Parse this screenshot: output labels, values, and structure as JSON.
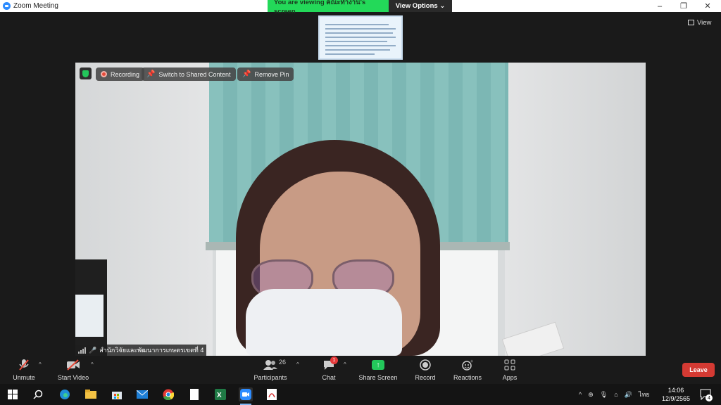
{
  "window": {
    "title": "Zoom Meeting",
    "min": "–",
    "restore": "❐",
    "close": "✕"
  },
  "banner": {
    "viewing": "You are viewing คณะทำงาน's screen",
    "view_options": "View Options ⌄"
  },
  "view_button": {
    "label": "View"
  },
  "video_overlay": {
    "recording": "Recording",
    "switch_label": "Switch to Shared Content",
    "remove_pin_label": "Remove Pin"
  },
  "participant": {
    "name": "สำนักวิจัยและพัฒนาการเกษตรเขตที่ 4"
  },
  "toolbar": {
    "unmute": "Unmute",
    "start_video": "Start Video",
    "participants": "Participants",
    "participants_count": "26",
    "chat": "Chat",
    "chat_badge": "1",
    "share_screen": "Share Screen",
    "record": "Record",
    "reactions": "Reactions",
    "apps": "Apps",
    "leave": "Leave"
  },
  "taskbar": {
    "language": "ไทย",
    "time": "14:06",
    "date": "12/9/2565",
    "notifications": "4"
  },
  "colors": {
    "green": "#23d959",
    "leave": "#d43a33",
    "accent": "#2d8cff"
  }
}
